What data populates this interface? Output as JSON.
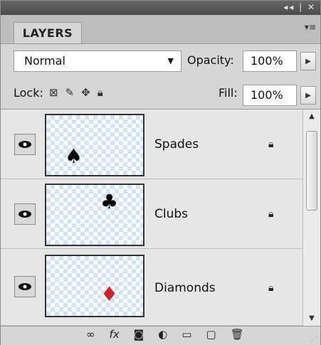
{
  "panel": {
    "title_controls": "◂◂ | ✕",
    "tab_label": "LAYERS",
    "panel_menu_glyph": "▾≡",
    "blend_mode": "Normal",
    "opacity_label": "Opacity:",
    "opacity_value": "100%",
    "lock_label": "Lock:",
    "fill_label": "Fill:",
    "fill_value": "100%",
    "lock_icons": [
      "transparent-pixels-lock-icon",
      "brush-lock-icon",
      "move-lock-icon",
      "all-lock-icon"
    ],
    "bottom_icons": [
      "link-icon",
      "fx-icon",
      "mask-icon",
      "adjustment-icon",
      "folder-icon",
      "new-layer-icon",
      "trash-icon"
    ]
  },
  "layers": [
    {
      "name": "Spades",
      "suit": "♠",
      "suit_color": "#000000"
    },
    {
      "name": "Clubs",
      "suit": "♣",
      "suit_color": "#000000"
    },
    {
      "name": "Diamonds",
      "suit": "♦",
      "suit_color": "#d61f26"
    }
  ]
}
